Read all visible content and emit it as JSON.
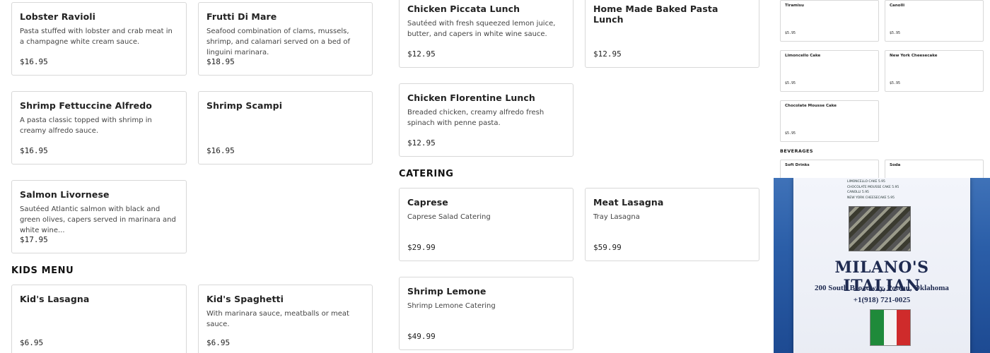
{
  "colA": {
    "cards": [
      {
        "name": "Lobster Ravioli",
        "desc": "Pasta stuffed with lobster and crab meat in a champagne white cream sauce.",
        "price": "$16.95"
      },
      {
        "name": "Frutti Di Mare",
        "desc": "Seafood combination of clams, mussels, shrimp, and calamari served on a bed of linguini marinara.",
        "price": "$18.95"
      },
      {
        "name": "Shrimp Fettuccine Alfredo",
        "desc": "A pasta classic topped with shrimp in creamy alfredo sauce.",
        "price": "$16.95"
      },
      {
        "name": "Shrimp Scampi",
        "desc": "",
        "price": "$16.95"
      },
      {
        "name": "Salmon Livornese",
        "desc": "Sautéed Atlantic salmon with black and green olives, capers served in marinara and white wine...",
        "price": "$17.95"
      }
    ],
    "kids_title": "KIDS MENU",
    "kids": [
      {
        "name": "Kid's Lasagna",
        "desc": "",
        "price": "$6.95"
      },
      {
        "name": "Kid's Spaghetti",
        "desc": "With marinara sauce, meatballs or meat sauce.",
        "price": "$6.95"
      }
    ]
  },
  "colB": {
    "lunch": [
      {
        "name": "Chicken Piccata Lunch",
        "desc": "Sautéed with fresh squeezed lemon juice, butter, and capers in white wine sauce.",
        "price": "$12.95"
      },
      {
        "name": "Home Made Baked Pasta Lunch",
        "desc": "",
        "price": "$12.95"
      },
      {
        "name": "Chicken Florentine Lunch",
        "desc": "Breaded chicken, creamy alfredo fresh spinach with penne pasta.",
        "price": "$12.95"
      }
    ],
    "catering_title": "CATERING",
    "catering": [
      {
        "name": "Caprese",
        "desc": "Caprese Salad Catering",
        "price": "$29.99"
      },
      {
        "name": "Meat Lasagna",
        "desc": "Tray Lasagna",
        "price": "$59.99"
      },
      {
        "name": "Shrimp Lemone",
        "desc": "Shrimp Lemone Catering",
        "price": "$49.99"
      }
    ]
  },
  "panel": {
    "desserts": [
      {
        "name": "Tiramisu",
        "price": "$5.95"
      },
      {
        "name": "Canolli",
        "price": "$5.95"
      },
      {
        "name": "Limoncello Cake",
        "price": "$5.95"
      },
      {
        "name": "New York Cheesecake",
        "price": "$5.95"
      },
      {
        "name": "Chocolate Mousse Cake",
        "price": "$5.95"
      }
    ],
    "beverages_title": "BEVERAGES",
    "beverages": [
      {
        "name": "Soft Drinks"
      },
      {
        "name": "Soda"
      }
    ],
    "photo": {
      "list": [
        "LIMONCELLO CAKE 5.95",
        "CHOCOLATE MOUSSE CAKE 5.95",
        "CANOLLI 5.95",
        "NEW YORK CHEESECAKE 5.95"
      ],
      "title": "MILANO'S ITALIAN",
      "address": "200 South Broadway, Poteau, Oklahoma",
      "phone": "+1(918) 721-0025",
      "flag_colors": [
        "#1f8a3a",
        "#f4f4f4",
        "#cf2b2b"
      ]
    }
  }
}
